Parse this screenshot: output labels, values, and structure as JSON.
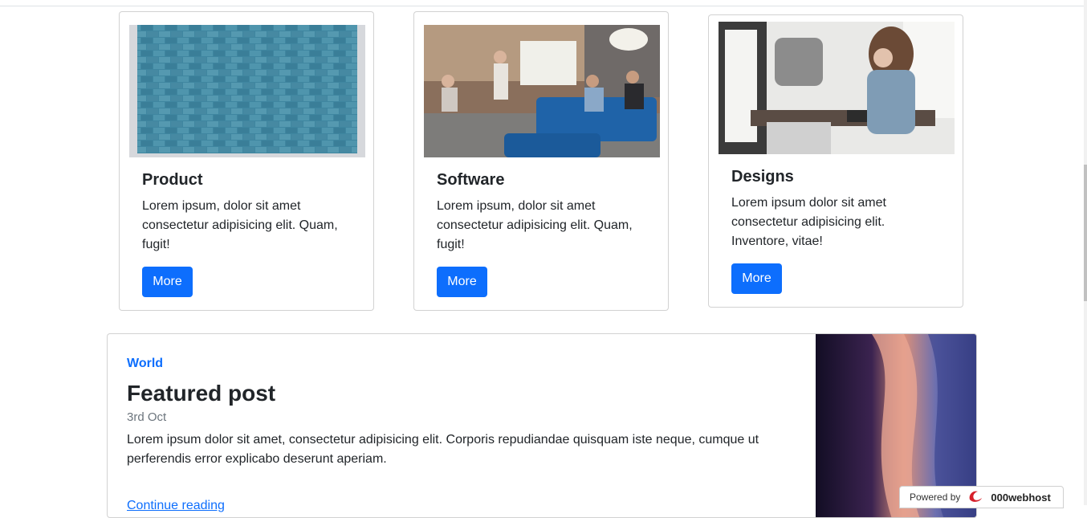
{
  "cards": [
    {
      "title": "Product",
      "text": "Lorem ipsum, dolor sit amet consectetur adipisicing elit. Quam, fugit!",
      "button": "More",
      "image": "brick-wall-image"
    },
    {
      "title": "Software",
      "text": "Lorem ipsum, dolor sit amet consectetur adipisicing elit. Quam, fugit!",
      "button": "More",
      "image": "team-meeting-image"
    },
    {
      "title": "Designs",
      "text": "Lorem ipsum dolor sit amet consectetur adipisicing elit. Inventore, vitae!",
      "button": "More",
      "image": "workspace-image"
    }
  ],
  "featured": {
    "category": "World",
    "title": "Featured post",
    "date": "3rd Oct",
    "text": "Lorem ipsum dolor sit amet, consectetur adipisicing elit. Corporis repudiandae quisquam iste neque, cumque ut perferendis error explicabo deserunt aperiam.",
    "link": "Continue reading"
  },
  "badge": {
    "label": "Powered by",
    "brand": "000webhost"
  },
  "colors": {
    "primary": "#0d6efd",
    "muted": "#6c757d",
    "text": "#212529"
  }
}
